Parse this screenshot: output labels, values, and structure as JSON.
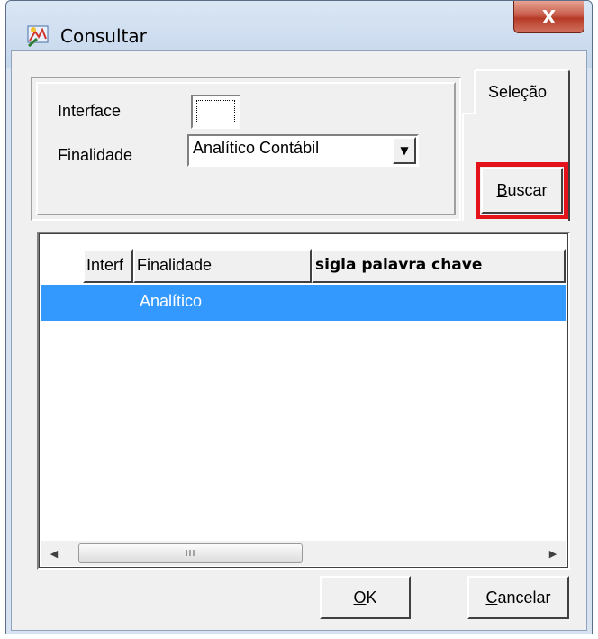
{
  "window": {
    "title": "Consultar",
    "close_glyph": "X"
  },
  "selection": {
    "interface_label": "Interface",
    "interface_value": "",
    "finalidade_label": "Finalidade",
    "finalidade_value": "Analítico Contábil",
    "tab_label": "Seleção",
    "buscar_pre": "",
    "buscar_mnemonic": "B",
    "buscar_rest": "uscar",
    "highlight_color": "#e3121b"
  },
  "grid": {
    "columns": [
      "Interf",
      "Finalidade",
      "sigla palavra chave"
    ],
    "rows": [
      {
        "interface": "",
        "finalidade": "Analítico",
        "sigla": ""
      }
    ],
    "selected_row_color": "#3399ff",
    "scroll_thumb_grip": "III",
    "scroll_left": "◀",
    "scroll_right": "▶"
  },
  "buttons": {
    "ok_mnemonic": "O",
    "ok_rest": "K",
    "cancel_mnemonic": "C",
    "cancel_rest": "ancelar"
  }
}
